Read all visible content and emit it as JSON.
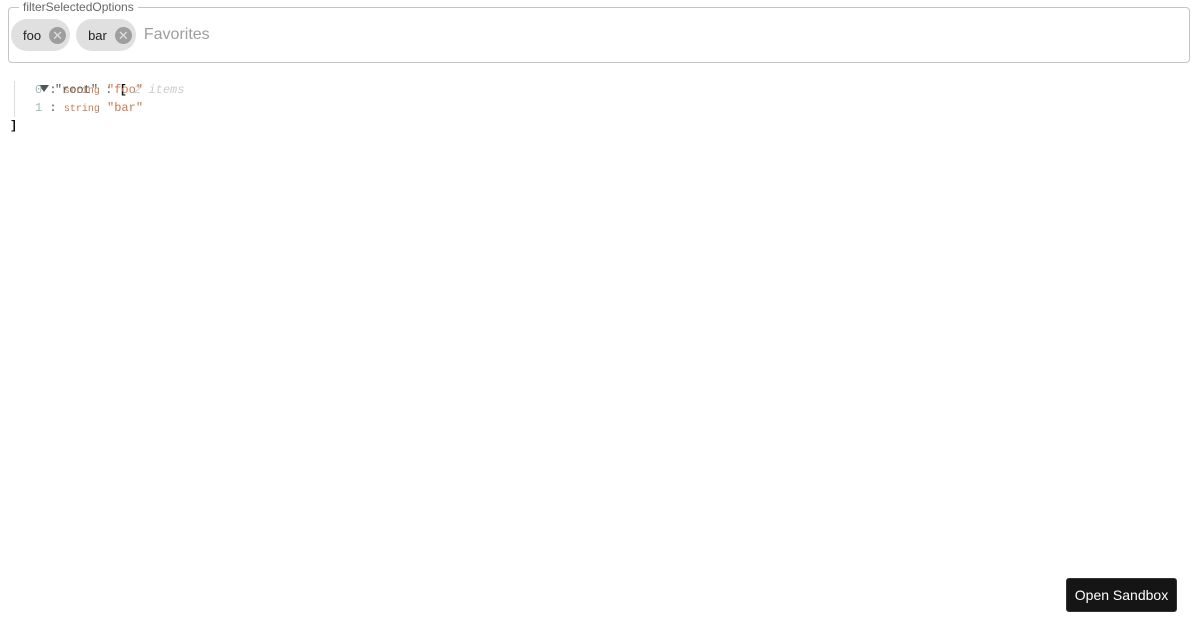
{
  "field": {
    "legend": "filterSelectedOptions",
    "chips": [
      {
        "label": "foo"
      },
      {
        "label": "bar"
      }
    ],
    "placeholder": "Favorites",
    "remove_icon": "✕"
  },
  "json_view": {
    "root_key": "\"root\"",
    "open_bracket": "[",
    "close_bracket": "]",
    "item_count": "2 items",
    "items": [
      {
        "index": "0",
        "type": "string",
        "value": "\"foo\""
      },
      {
        "index": "1",
        "type": "string",
        "value": "\"bar\""
      }
    ]
  },
  "sandbox_button": "Open Sandbox"
}
